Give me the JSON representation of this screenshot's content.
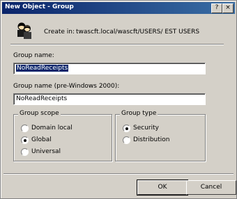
{
  "window": {
    "title": "New Object - Group",
    "minimize_glyph": "?",
    "close_glyph": "×"
  },
  "header": {
    "create_in_label": "Create in:",
    "create_in_path": "twascft.local/wascft/USERS/ EST USERS",
    "icon": "group-icon"
  },
  "fields": {
    "group_name_label": "Group name:",
    "group_name_value": "NoReadReceipts",
    "pre2000_label": "Group name (pre-Windows 2000):",
    "pre2000_value": "NoReadReceipts"
  },
  "group_scope": {
    "legend": "Group scope",
    "options": [
      {
        "label": "Domain local",
        "selected": false
      },
      {
        "label": "Global",
        "selected": true
      },
      {
        "label": "Universal",
        "selected": false
      }
    ]
  },
  "group_type": {
    "legend": "Group type",
    "options": [
      {
        "label": "Security",
        "selected": true
      },
      {
        "label": "Distribution",
        "selected": false
      }
    ]
  },
  "buttons": {
    "ok": "OK",
    "cancel": "Cancel"
  },
  "colors": {
    "dialog_bg": "#d4d0c8",
    "title_start": "#0a246a",
    "title_end": "#3a6ea5",
    "selection": "#0a246a"
  }
}
